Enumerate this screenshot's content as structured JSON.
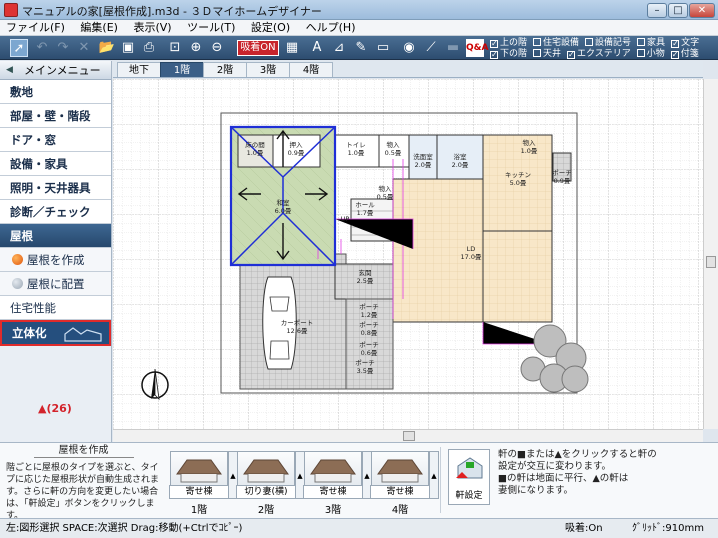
{
  "window": {
    "title": "マニュアルの家[屋根作成].m3d - ３Ｄマイホームデザイナー",
    "min": "–",
    "max": "□",
    "close": "✕"
  },
  "menu": [
    "ファイル(F)",
    "編集(E)",
    "表示(V)",
    "ツール(T)",
    "設定(O)",
    "ヘルプ(H)"
  ],
  "toolbar": {
    "snap_label": "吸着ON",
    "options_row1": [
      {
        "label": "上の階",
        "checked": true
      },
      {
        "label": "住宅設備",
        "checked": false
      },
      {
        "label": "設備記号",
        "checked": false
      },
      {
        "label": "家具",
        "checked": false
      },
      {
        "label": "文字",
        "checked": true
      }
    ],
    "options_row2": [
      {
        "label": "下の階",
        "checked": true
      },
      {
        "label": "天井",
        "checked": false
      },
      {
        "label": "エクステリア",
        "checked": true
      },
      {
        "label": "小物",
        "checked": false
      },
      {
        "label": "付箋",
        "checked": true
      }
    ]
  },
  "sidebar": {
    "main_menu": "メインメニュー",
    "items": [
      "敷地",
      "部屋・壁・階段",
      "ドア・窓",
      "設備・家具",
      "照明・天井器具",
      "診断／チェック"
    ],
    "roof_header": "屋根",
    "roof_sub": [
      "屋根を作成",
      "屋根に配置"
    ],
    "housing": "住宅性能",
    "solid": "立体化",
    "annotation": "▲(26)"
  },
  "floor_tabs": [
    "地下",
    "1階",
    "2階",
    "3階",
    "4階"
  ],
  "active_floor": "1階",
  "plan": {
    "rooms": [
      {
        "name": "床の間",
        "area": "1.0畳"
      },
      {
        "name": "押入",
        "area": "0.9畳"
      },
      {
        "name": "和室",
        "area": "6.0畳"
      },
      {
        "name": "トイレ",
        "area": "1.0畳"
      },
      {
        "name": "物入",
        "area": "0.5畳"
      },
      {
        "name": "洗面室",
        "area": "2.0畳"
      },
      {
        "name": "浴室",
        "area": "2.0畳"
      },
      {
        "name": "物入",
        "area": "1.0畳"
      },
      {
        "name": "キッチン",
        "area": "5.0畳"
      },
      {
        "name": "ポーチ",
        "area": "0.9畳"
      },
      {
        "name": "物入",
        "area": "0.5畳"
      },
      {
        "name": "ホール",
        "area": "1.7畳"
      },
      {
        "name": "UP",
        "area": ""
      },
      {
        "name": "LD",
        "area": "17.0畳"
      },
      {
        "name": "玄関",
        "area": "2.5畳"
      },
      {
        "name": "ポーチ",
        "area": "1.2畳"
      },
      {
        "name": "ポーチ",
        "area": "0.8畳"
      },
      {
        "name": "カーポート",
        "area": "12.6畳"
      },
      {
        "name": "ポーチ",
        "area": "0.6畳"
      },
      {
        "name": "ポーチ",
        "area": "3.5畳"
      }
    ]
  },
  "bottom": {
    "help_title": "屋根を作成",
    "help_text": "階ごとに屋根のタイプを選ぶと、タイプに応じた屋根形状が自動生成されます。さらに軒の方向を変更したい場合は、「軒設定」ボタンをクリックします。",
    "roof_tiles": [
      {
        "type": "寄せ棟",
        "floor": "1階"
      },
      {
        "type": "切り妻(横)",
        "floor": "2階"
      },
      {
        "type": "寄せ棟",
        "floor": "3階"
      },
      {
        "type": "寄せ棟",
        "floor": "4階"
      }
    ],
    "eaves_button": "軒設定",
    "eaves_note": [
      "軒の■または▲をクリックすると軒の",
      "設定が交互に変わります。",
      "■の軒は地面に平行、▲の軒は",
      "妻側になります。"
    ]
  },
  "status": {
    "left": "左:図形選択 SPACE:次選択 Drag:移動(+Ctrlでｺﾋﾟｰ)",
    "snap": "吸着:On",
    "grid": "ｸﾞﾘｯﾄﾞ:910mm"
  },
  "colors": {
    "accent": "#254f7e",
    "highlight": "#e02b2b",
    "roof_outline": "#1f2fd6"
  }
}
